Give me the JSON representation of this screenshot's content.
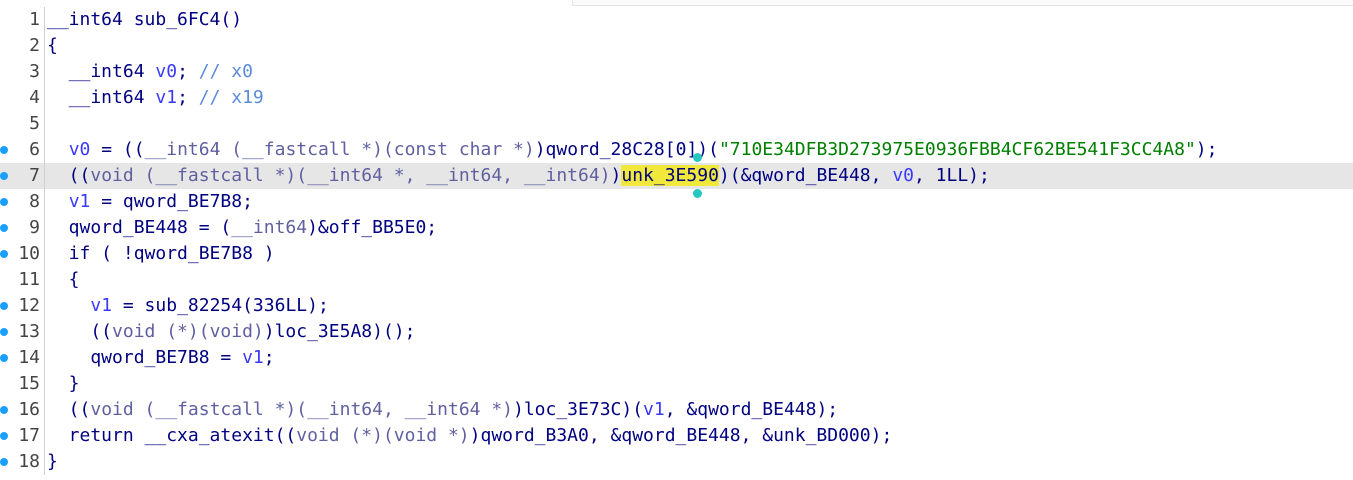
{
  "editor": {
    "lines": [
      {
        "num": "1",
        "dot": false,
        "current": false,
        "tokens": [
          {
            "t": "__int64 sub_6FC4()",
            "c": "plain"
          }
        ]
      },
      {
        "num": "2",
        "dot": false,
        "current": false,
        "tokens": [
          {
            "t": "{",
            "c": "plain"
          }
        ]
      },
      {
        "num": "3",
        "dot": false,
        "current": false,
        "tokens": [
          {
            "t": "  __int64 ",
            "c": "plain"
          },
          {
            "t": "v0",
            "c": "var"
          },
          {
            "t": "; ",
            "c": "plain"
          },
          {
            "t": "// x0",
            "c": "cmt"
          }
        ]
      },
      {
        "num": "4",
        "dot": false,
        "current": false,
        "tokens": [
          {
            "t": "  __int64 ",
            "c": "plain"
          },
          {
            "t": "v1",
            "c": "var"
          },
          {
            "t": "; ",
            "c": "plain"
          },
          {
            "t": "// x19",
            "c": "cmt"
          }
        ]
      },
      {
        "num": "5",
        "dot": false,
        "current": false,
        "tokens": []
      },
      {
        "num": "6",
        "dot": true,
        "current": false,
        "tokens": [
          {
            "t": "  ",
            "c": "plain"
          },
          {
            "t": "v0",
            "c": "var"
          },
          {
            "t": " = ((",
            "c": "plain"
          },
          {
            "t": "__int64 (__fastcall *)(const char *)",
            "c": "type"
          },
          {
            "t": ")qword_28C28[",
            "c": "plain"
          },
          {
            "t": "0",
            "c": "plain"
          },
          {
            "t": "])(",
            "c": "plain"
          },
          {
            "t": "\"710E34DFB3D273975E0936FBB4CF62BE541F3CC4A8\"",
            "c": "str"
          },
          {
            "t": ");",
            "c": "plain"
          }
        ]
      },
      {
        "num": "7",
        "dot": true,
        "current": true,
        "tokens": [
          {
            "t": "  ((",
            "c": "plain"
          },
          {
            "t": "void (__fastcall *)(__int64 *, __int64, __int64)",
            "c": "type"
          },
          {
            "t": ")",
            "c": "plain"
          },
          {
            "t": "unk_3E590",
            "c": "hl"
          },
          {
            "t": ")(&qword_BE448, ",
            "c": "plain"
          },
          {
            "t": "v0",
            "c": "var"
          },
          {
            "t": ", 1LL);",
            "c": "plain"
          }
        ]
      },
      {
        "num": "8",
        "dot": true,
        "current": false,
        "tokens": [
          {
            "t": "  ",
            "c": "plain"
          },
          {
            "t": "v1",
            "c": "var"
          },
          {
            "t": " = qword_BE7B8;",
            "c": "plain"
          }
        ]
      },
      {
        "num": "9",
        "dot": true,
        "current": false,
        "tokens": [
          {
            "t": "  qword_BE448 = (",
            "c": "plain"
          },
          {
            "t": "__int64",
            "c": "type"
          },
          {
            "t": ")&off_BB5E0;",
            "c": "plain"
          }
        ]
      },
      {
        "num": "10",
        "dot": true,
        "current": false,
        "tokens": [
          {
            "t": "  if ( !qword_BE7B8 )",
            "c": "plain"
          }
        ]
      },
      {
        "num": "11",
        "dot": false,
        "current": false,
        "tokens": [
          {
            "t": "  {",
            "c": "plain"
          }
        ]
      },
      {
        "num": "12",
        "dot": true,
        "current": false,
        "tokens": [
          {
            "t": "    ",
            "c": "plain"
          },
          {
            "t": "v1",
            "c": "var"
          },
          {
            "t": " = sub_82254(336LL);",
            "c": "plain"
          }
        ]
      },
      {
        "num": "13",
        "dot": true,
        "current": false,
        "tokens": [
          {
            "t": "    ((",
            "c": "plain"
          },
          {
            "t": "void (*)(void)",
            "c": "type"
          },
          {
            "t": ")loc_3E5A8)();",
            "c": "plain"
          }
        ]
      },
      {
        "num": "14",
        "dot": true,
        "current": false,
        "tokens": [
          {
            "t": "    qword_BE7B8 = ",
            "c": "plain"
          },
          {
            "t": "v1",
            "c": "var"
          },
          {
            "t": ";",
            "c": "plain"
          }
        ]
      },
      {
        "num": "15",
        "dot": false,
        "current": false,
        "tokens": [
          {
            "t": "  }",
            "c": "plain"
          }
        ]
      },
      {
        "num": "16",
        "dot": true,
        "current": false,
        "tokens": [
          {
            "t": "  ((",
            "c": "plain"
          },
          {
            "t": "void (__fastcall *)(__int64, __int64 *)",
            "c": "type"
          },
          {
            "t": ")loc_3E73C)(",
            "c": "plain"
          },
          {
            "t": "v1",
            "c": "var"
          },
          {
            "t": ", &qword_BE448);",
            "c": "plain"
          }
        ]
      },
      {
        "num": "17",
        "dot": true,
        "current": false,
        "tokens": [
          {
            "t": "  return __cxa_atexit((",
            "c": "plain"
          },
          {
            "t": "void (*)(void *)",
            "c": "type"
          },
          {
            "t": ")qword_B3A0, &qword_BE448, &unk_BD000);",
            "c": "plain"
          }
        ]
      },
      {
        "num": "18",
        "dot": true,
        "current": false,
        "tokens": [
          {
            "t": "}",
            "c": "plain"
          }
        ]
      }
    ]
  },
  "colors": {
    "background": "#ffffff",
    "current_line": "#e6e6e6",
    "highlight": "#f0e93c",
    "breakpoint_dot": "#1a9fff",
    "keyword": "#000080",
    "type_cast": "#6060a0",
    "variable": "#3a3aff",
    "string": "#008000",
    "comment": "#5b8bd8"
  }
}
